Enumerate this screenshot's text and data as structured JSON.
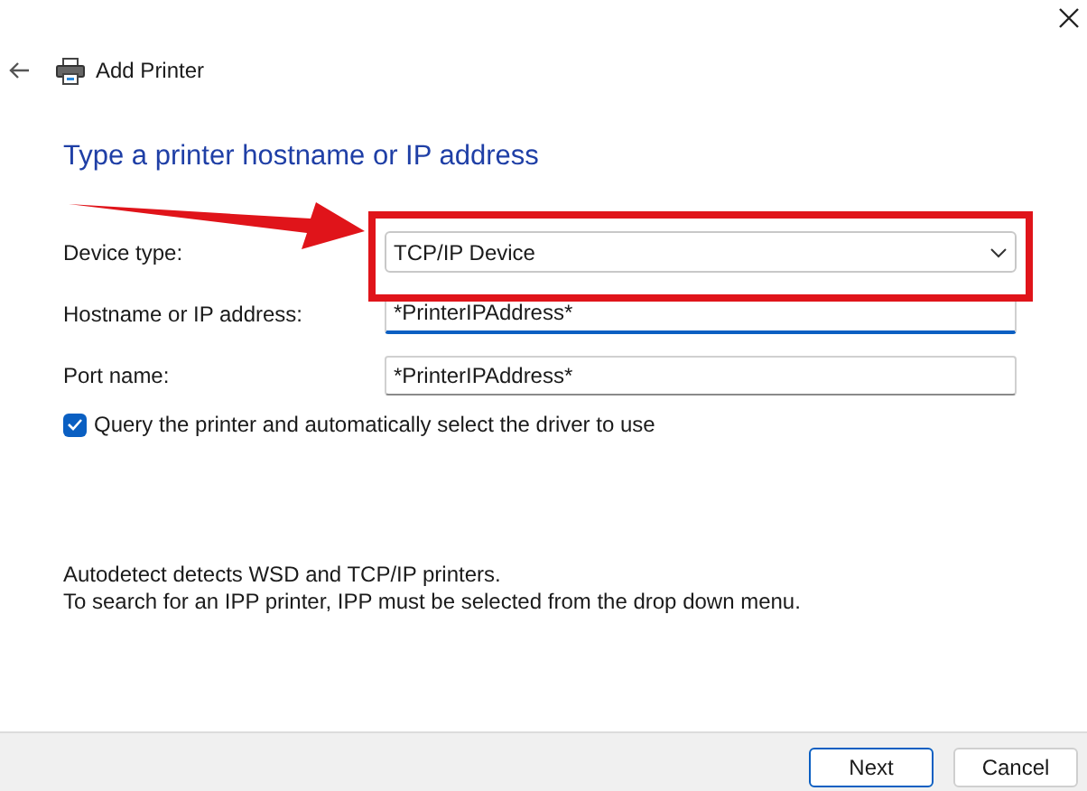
{
  "window": {
    "title": "Add Printer"
  },
  "heading": "Type a printer hostname or IP address",
  "fields": [
    {
      "kind": "dropdown",
      "label": "Device type:",
      "value": "TCP/IP Device",
      "highlighted": true,
      "focused": false
    },
    {
      "kind": "text",
      "label": "Hostname or IP address:",
      "value": "*PrinterIPAddress*",
      "highlighted": false,
      "focused": true
    },
    {
      "kind": "text",
      "label": "Port name:",
      "value": "*PrinterIPAddress*",
      "highlighted": false,
      "focused": false
    }
  ],
  "query_checkbox": {
    "label": "Query the printer and automatically select the driver to use",
    "checked": true
  },
  "notes": [
    "Autodetect detects WSD and TCP/IP printers.",
    "To search for an IPP printer, IPP must be selected from the drop down menu."
  ],
  "buttons": [
    {
      "label": "Next",
      "selected": true
    },
    {
      "label": "Cancel",
      "selected": false
    }
  ]
}
